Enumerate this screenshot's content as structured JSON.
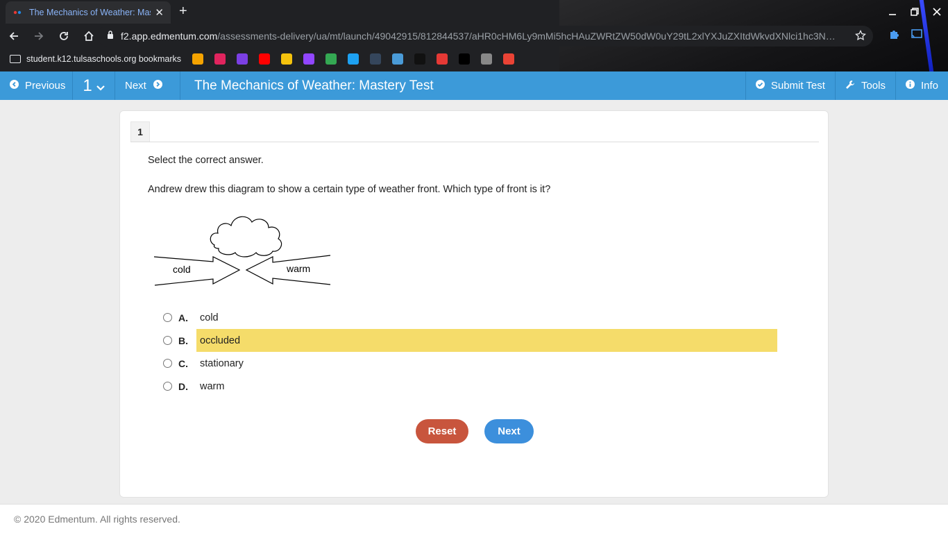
{
  "browser": {
    "tab_title": "The Mechanics of Weather: Mastery Test",
    "url_host": "f2.app.edmentum.com",
    "url_rest": "/assessments-delivery/ua/mt/launch/49042915/812844537/aHR0cHM6Ly9mMi5hcHAuZWRtZW50dW0uY29tL2xlYXJuZXItdWkvdXNlci1hc3N…",
    "bookmark_folder": "student.k12.tulsaschools.org bookmarks",
    "bookmark_icons": [
      "#f4a300",
      "#e0245e",
      "#7b3fe4",
      "#ff0000",
      "#f4c20d",
      "#9146ff",
      "#34a853",
      "#1da1f2",
      "#35465c",
      "#4a9bd8",
      "#111111",
      "#e53935",
      "#000000",
      "#888888",
      "#ea4335"
    ]
  },
  "appbar": {
    "previous_label": "Previous",
    "question_number": "1",
    "next_label": "Next",
    "title": "The Mechanics of Weather: Mastery Test",
    "submit_label": "Submit Test",
    "tools_label": "Tools",
    "info_label": "Info"
  },
  "question": {
    "number": "1",
    "instruction": "Select the correct answer.",
    "prompt": "Andrew drew this diagram to show a certain type of weather front. Which type of front is it?",
    "diagram_labels": {
      "left": "cold",
      "right": "warm"
    },
    "choices": [
      {
        "letter": "A.",
        "text": "cold"
      },
      {
        "letter": "B.",
        "text": "occluded"
      },
      {
        "letter": "C.",
        "text": "stationary"
      },
      {
        "letter": "D.",
        "text": "warm"
      }
    ],
    "highlighted_choice": "B."
  },
  "actions": {
    "reset_label": "Reset",
    "next_label": "Next"
  },
  "footer": {
    "copyright": "© 2020 Edmentum. All rights reserved."
  }
}
